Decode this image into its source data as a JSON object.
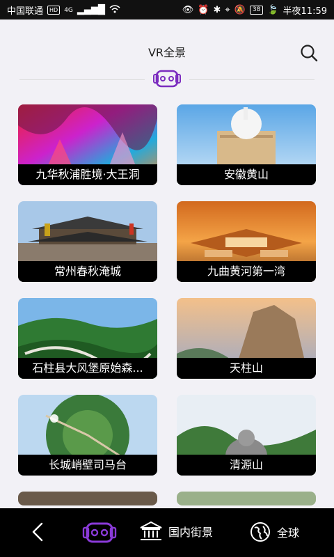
{
  "status_bar": {
    "carrier": "中国联通",
    "hd_badge": "HD",
    "network": "4G",
    "battery": "38",
    "time": "半夜11:59"
  },
  "header": {
    "title": "VR全景",
    "search_icon": "search-icon",
    "badge_icon": "vr-headset-icon"
  },
  "cards": [
    {
      "label": "九华秋浦胜境·大王洞"
    },
    {
      "label": "安徽黄山"
    },
    {
      "label": "常州春秋淹城"
    },
    {
      "label": "九曲黄河第一湾"
    },
    {
      "label": "石柱县大风堡原始森..."
    },
    {
      "label": "天柱山"
    },
    {
      "label": "长城峭壁司马台"
    },
    {
      "label": "清源山"
    }
  ],
  "bottom_nav": {
    "back_icon": "back-chevron-icon",
    "vr_icon": "vr-headset-icon",
    "domestic_label": "国内街景",
    "global_label": "全球"
  },
  "colors": {
    "accent": "#7b2cbf",
    "background": "#f2f1f6",
    "nav": "#000000"
  }
}
